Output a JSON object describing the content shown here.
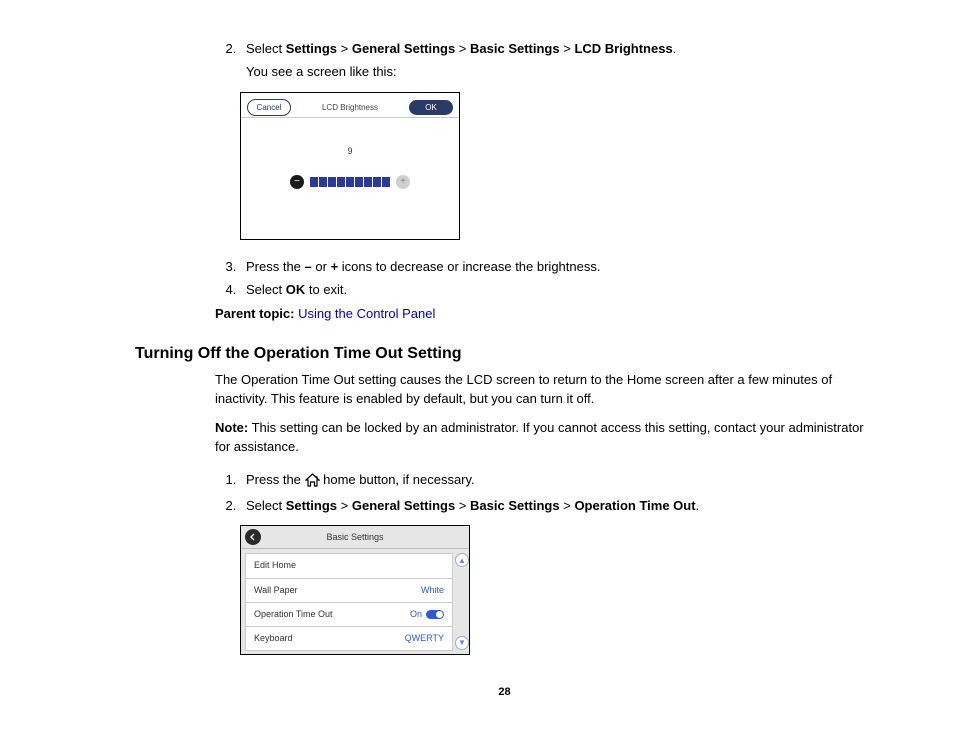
{
  "step2": {
    "num": "2.",
    "prefix": "Select ",
    "p1": "Settings",
    "s": " > ",
    "p2": "General Settings",
    "p3": "Basic Settings",
    "p4": "LCD Brightness",
    "suffix": ".",
    "after": "You see a screen like this:"
  },
  "lcd": {
    "cancel": "Cancel",
    "title": "LCD Brightness",
    "ok": "OK",
    "value": "9"
  },
  "step3": {
    "prefix": "Press the ",
    "minus": "–",
    "mid1": " or ",
    "plus": "+",
    "suffix": " icons to decrease or increase the brightness."
  },
  "step4": {
    "prefix": "Select ",
    "ok": "OK",
    "suffix": " to exit."
  },
  "parent": {
    "label": "Parent topic: ",
    "link": "Using the Control Panel"
  },
  "section": {
    "heading": "Turning Off the Operation Time Out Setting",
    "p1": "The Operation Time Out setting causes the LCD screen to return to the Home screen after a few minutes of inactivity. This feature is enabled by default, but you can turn it off.",
    "note_label": "Note:",
    "note_body": " This setting can be locked by an administrator. If you cannot access this setting, contact your administrator for assistance."
  },
  "s2steps": {
    "s1a": "Press the ",
    "s1b": " home button, if necessary.",
    "s2prefix": "Select ",
    "p1": "Settings",
    "sep": " > ",
    "p2": "General Settings",
    "p3": "Basic Settings",
    "p4": "Operation Time Out",
    "suffix": "."
  },
  "bs": {
    "title": "Basic Settings",
    "items": [
      {
        "label": "Edit Home",
        "value": ""
      },
      {
        "label": "Wall Paper",
        "value": "White"
      },
      {
        "label": "Operation Time Out",
        "value": "On",
        "toggle": true
      },
      {
        "label": "Keyboard",
        "value": "QWERTY"
      }
    ]
  },
  "page": "28"
}
